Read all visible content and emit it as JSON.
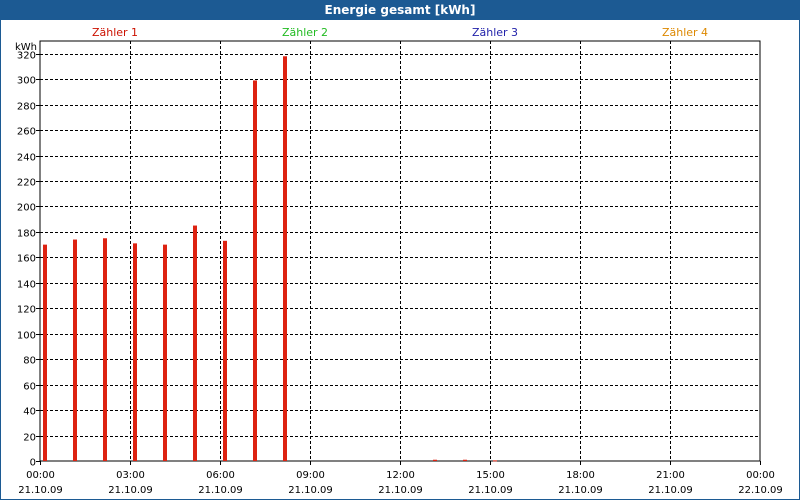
{
  "title": "Energie gesamt [kWh]",
  "colors": {
    "titlebar": "#1c5a93",
    "grid": "#000000",
    "bar": "#dd2211"
  },
  "legend": [
    {
      "label": "Zähler 1",
      "color": "#cc1100"
    },
    {
      "label": "Zähler 2",
      "color": "#22bb22"
    },
    {
      "label": "Zähler 3",
      "color": "#2222aa"
    },
    {
      "label": "Zähler 4",
      "color": "#dd8800"
    }
  ],
  "chart_data": {
    "type": "bar",
    "ylabel": "kWh",
    "ylim": [
      0,
      330
    ],
    "yticks": [
      0,
      20,
      40,
      60,
      80,
      100,
      120,
      140,
      160,
      180,
      200,
      220,
      240,
      260,
      280,
      300,
      320
    ],
    "xlim": [
      0,
      24
    ],
    "xticks": [
      {
        "time": "00:00",
        "date": "21.10.09"
      },
      {
        "time": "03:00",
        "date": "21.10.09"
      },
      {
        "time": "06:00",
        "date": "21.10.09"
      },
      {
        "time": "09:00",
        "date": "21.10.09"
      },
      {
        "time": "12:00",
        "date": "21.10.09"
      },
      {
        "time": "15:00",
        "date": "21.10.09"
      },
      {
        "time": "18:00",
        "date": "21.10.09"
      },
      {
        "time": "21:00",
        "date": "21.10.09"
      },
      {
        "time": "00:00",
        "date": "22.10.09"
      }
    ],
    "grid": true,
    "series": [
      {
        "name": "Zähler 1",
        "x": [
          0,
          1,
          2,
          3,
          4,
          5,
          6,
          7,
          8,
          13,
          14,
          15
        ],
        "values": [
          170,
          174,
          175,
          171,
          170,
          185,
          173,
          299,
          318,
          1,
          1,
          0.5
        ]
      }
    ]
  }
}
